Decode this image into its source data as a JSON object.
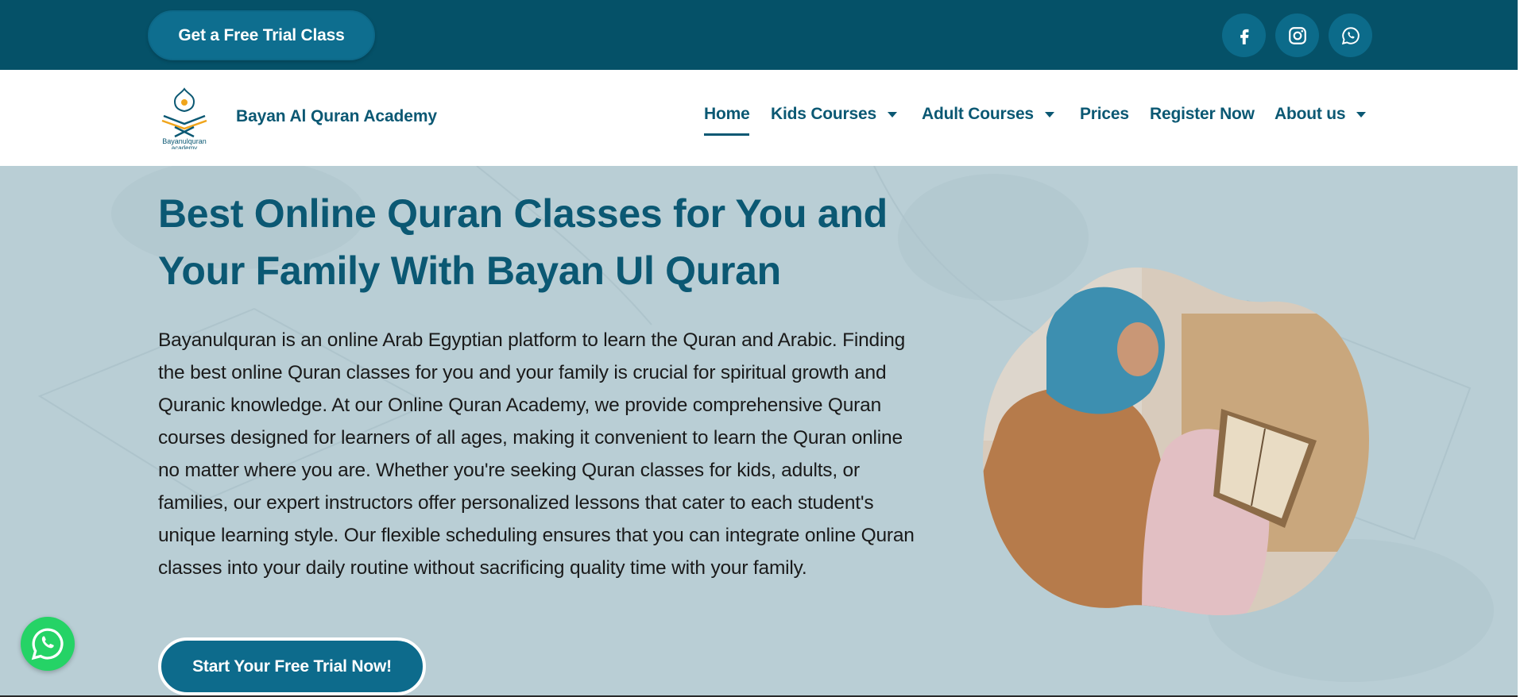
{
  "topbar": {
    "trial_button": "Get a Free Trial Class",
    "social": [
      {
        "name": "facebook-icon"
      },
      {
        "name": "instagram-icon"
      },
      {
        "name": "whatsapp-icon"
      }
    ]
  },
  "nav": {
    "logo_text_line1": "Bayanulquran",
    "logo_text_line2": "academy",
    "brand": "Bayan Al Quran Academy",
    "items": [
      {
        "label": "Home",
        "active": true,
        "dropdown": false
      },
      {
        "label": "Kids Courses",
        "dropdown": true
      },
      {
        "label": "Adult Courses",
        "dropdown": true
      },
      {
        "label": "Prices",
        "dropdown": false
      },
      {
        "label": "Register Now",
        "dropdown": false
      },
      {
        "label": "About us",
        "dropdown": true
      }
    ]
  },
  "hero": {
    "title": "Best Online Quran Classes for You and Your Family With Bayan Ul Quran",
    "description": "Bayanulquran is an online Arab Egyptian platform to learn the Quran and Arabic. Finding the best online Quran classes for you and your family is crucial for spiritual growth and Quranic knowledge. At our Online Quran Academy, we provide comprehensive Quran courses designed for learners of all ages, making it convenient to learn the Quran online no matter where you are. Whether you're seeking Quran classes for kids, adults, or families, our expert instructors offer personalized lessons that cater to each student's unique learning style. Our flexible scheduling ensures that you can integrate online Quran classes into your daily routine without sacrificing quality time with your family.",
    "cta": "Start Your Free Trial Now!"
  },
  "colors": {
    "primary": "#055168",
    "accent": "#0d6b8c",
    "hero_bg": "#b8cdd4",
    "whatsapp": "#25d366"
  }
}
